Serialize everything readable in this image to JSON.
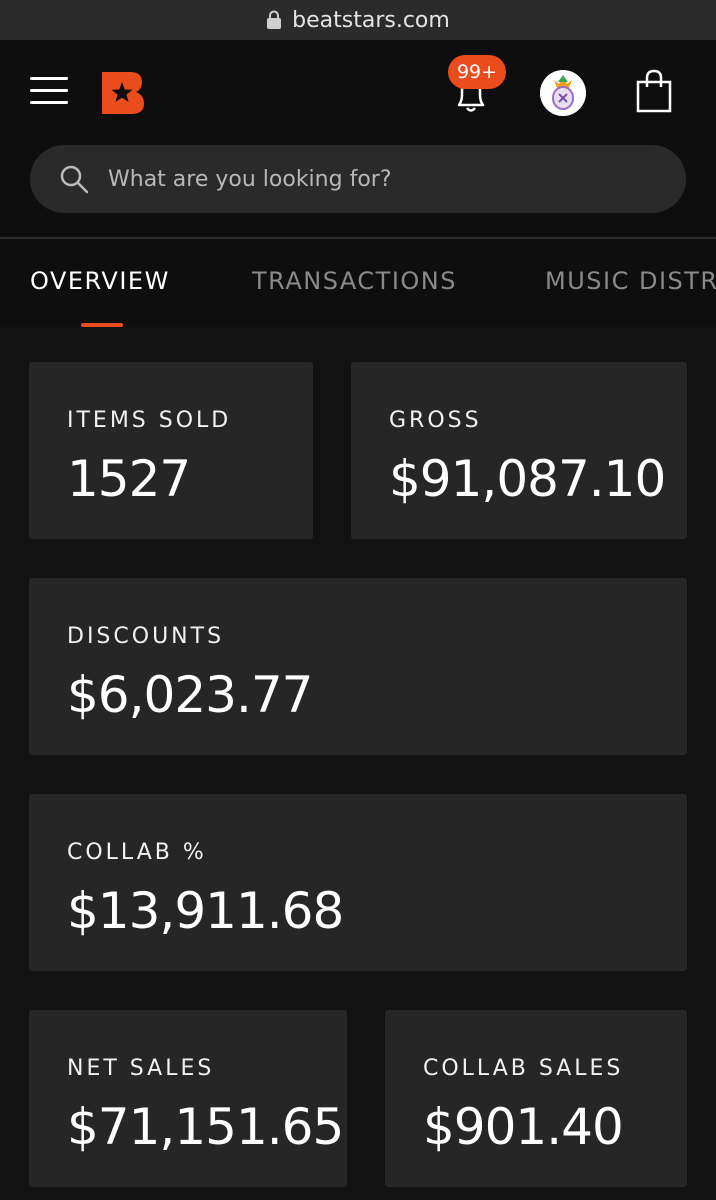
{
  "browser": {
    "url": "beatstars.com"
  },
  "header": {
    "notifications_badge": "99+",
    "search_placeholder": "What are you looking for?"
  },
  "tabs": [
    {
      "label": "OVERVIEW",
      "active": true
    },
    {
      "label": "TRANSACTIONS",
      "active": false
    },
    {
      "label": "MUSIC DISTR",
      "active": false
    }
  ],
  "stats": {
    "items_sold": {
      "label": "ITEMS SOLD",
      "value": "1527"
    },
    "gross": {
      "label": "GROSS",
      "value": "$91,087.10"
    },
    "discounts": {
      "label": "DISCOUNTS",
      "value": "$6,023.77"
    },
    "collab_pct": {
      "label": "COLLAB %",
      "value": "$13,911.68"
    },
    "net_sales": {
      "label": "NET SALES",
      "value": "$71,151.65"
    },
    "collab_sales": {
      "label": "COLLAB SALES",
      "value": "$901.40"
    }
  },
  "colors": {
    "accent": "#ea4c1d",
    "background": "#121212",
    "card": "#262626"
  }
}
